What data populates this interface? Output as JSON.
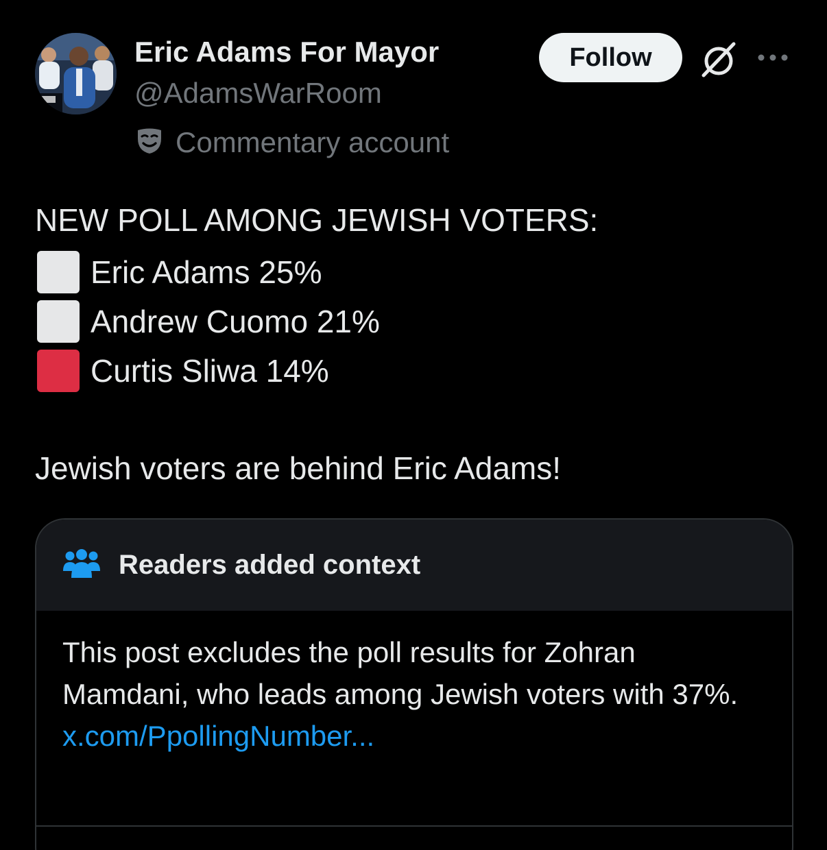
{
  "post": {
    "author": {
      "name": "Eric Adams For Mayor",
      "handle": "@AdamsWarRoom",
      "label": "Commentary account"
    },
    "follow_label": "Follow",
    "headline": "NEW POLL AMONG JEWISH VOTERS:",
    "poll": [
      {
        "text": "Eric Adams 25%",
        "color": "#e6e7e8"
      },
      {
        "text": "Andrew Cuomo 21%",
        "color": "#e6e7e8"
      },
      {
        "text": "Curtis Sliwa 14%",
        "color": "#dd2e44"
      }
    ],
    "tagline": "Jewish voters are behind Eric Adams!"
  },
  "note": {
    "title": "Readers added context",
    "body": "This post excludes the poll results for Zohran Mamdani, who leads among Jewish voters with 37%.",
    "link": "x.com/PpollingNumber..."
  },
  "colors": {
    "background": "#000000",
    "text": "#e7e9ea",
    "muted": "#71767b",
    "link": "#1d9bf0",
    "note_header": "#16181c",
    "border": "#2f3336"
  },
  "icons": {
    "more": "more-icon",
    "grok": "grok-icon",
    "commentary": "theater-mask-icon",
    "note": "people-icon"
  }
}
